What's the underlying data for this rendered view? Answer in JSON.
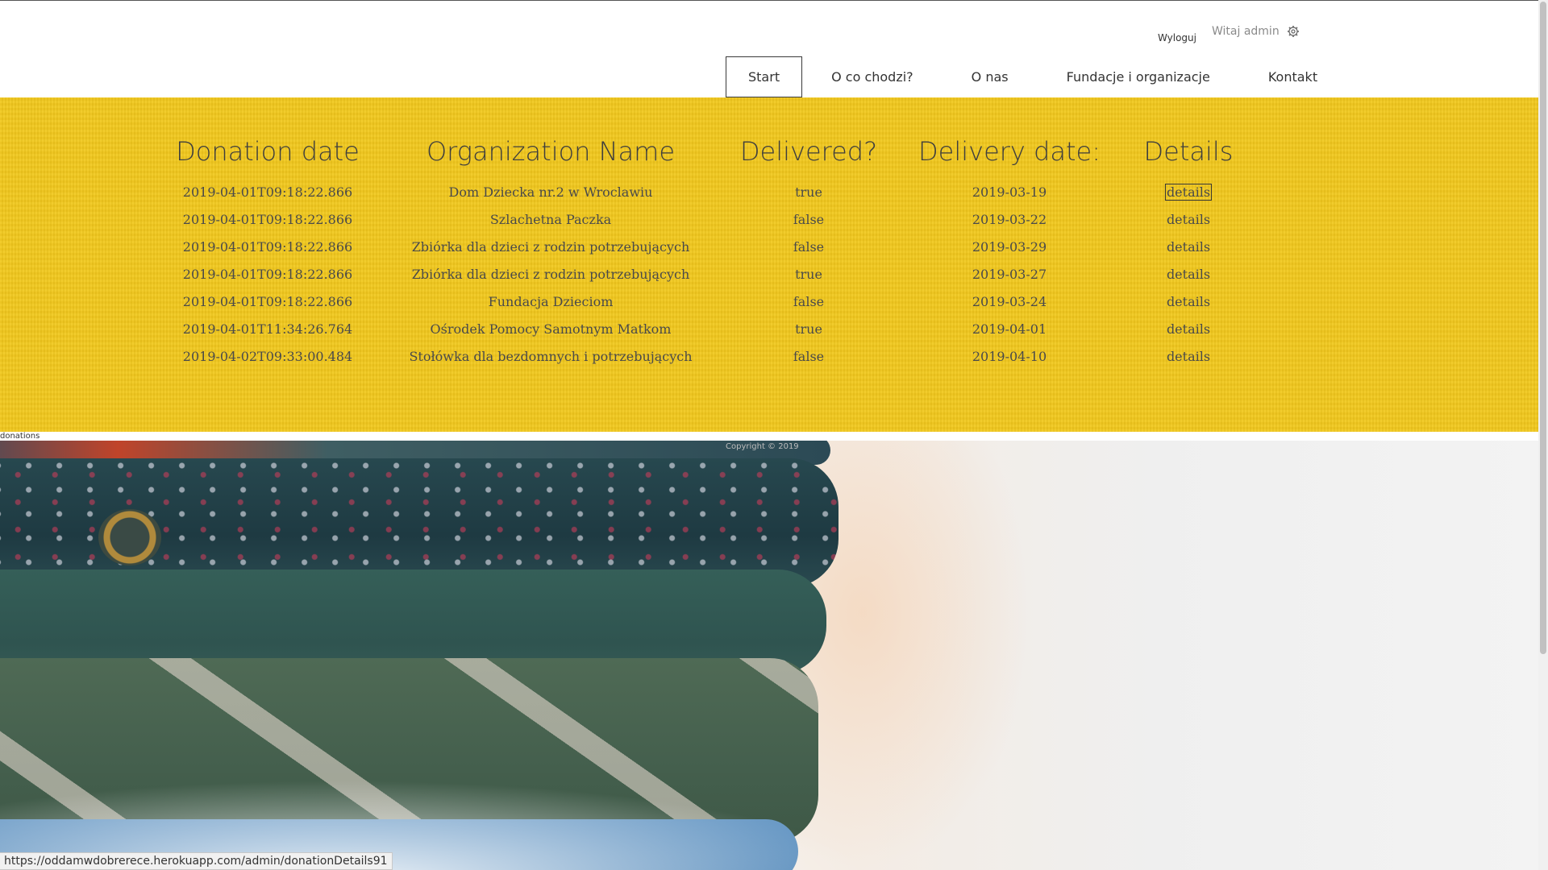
{
  "header": {
    "logout_label": "Wyloguj",
    "greeting": "Witaj admin",
    "settings_icon": "gear-icon",
    "nav": [
      {
        "label": "Start",
        "active": true
      },
      {
        "label": "O co chodzi?",
        "active": false
      },
      {
        "label": "O nas",
        "active": false
      },
      {
        "label": "Fundacje i organizacje",
        "active": false
      },
      {
        "label": "Kontakt",
        "active": false
      }
    ]
  },
  "donations_table": {
    "headers": [
      "Donation date",
      "Organization Name",
      "Delivered?",
      "Delivery date:",
      "Details"
    ],
    "rows": [
      {
        "donation_date": "2019-04-01T09:18:22.866",
        "organization": "Dom Dziecka nr.2 w Wroclawiu",
        "delivered": "true",
        "delivery_date": "2019-03-19",
        "details": "details"
      },
      {
        "donation_date": "2019-04-01T09:18:22.866",
        "organization": "Szlachetna Paczka",
        "delivered": "false",
        "delivery_date": "2019-03-22",
        "details": "details"
      },
      {
        "donation_date": "2019-04-01T09:18:22.866",
        "organization": "Zbiórka dla dzieci z rodzin potrzebujących",
        "delivered": "false",
        "delivery_date": "2019-03-29",
        "details": "details"
      },
      {
        "donation_date": "2019-04-01T09:18:22.866",
        "organization": "Zbiórka dla dzieci z rodzin potrzebujących",
        "delivered": "true",
        "delivery_date": "2019-03-27",
        "details": "details"
      },
      {
        "donation_date": "2019-04-01T09:18:22.866",
        "organization": "Fundacja Dzieciom",
        "delivered": "false",
        "delivery_date": "2019-03-24",
        "details": "details"
      },
      {
        "donation_date": "2019-04-01T11:34:26.764",
        "organization": "Ośrodek Pomocy Samotnym Matkom",
        "delivered": "true",
        "delivery_date": "2019-04-01",
        "details": "details"
      },
      {
        "donation_date": "2019-04-02T09:33:00.484",
        "organization": "Stołówka dla bezdomnych i potrzebujących",
        "delivered": "false",
        "delivery_date": "2019-04-10",
        "details": "details"
      }
    ]
  },
  "section_label": "donations",
  "copyright": "Copyright © 2019",
  "status_url": "https://oddamwdobrerece.herokuapp.com/admin/donationDetails91",
  "colors": {
    "band_yellow": "#f2c81d",
    "text_dark": "#3e3e3e"
  }
}
